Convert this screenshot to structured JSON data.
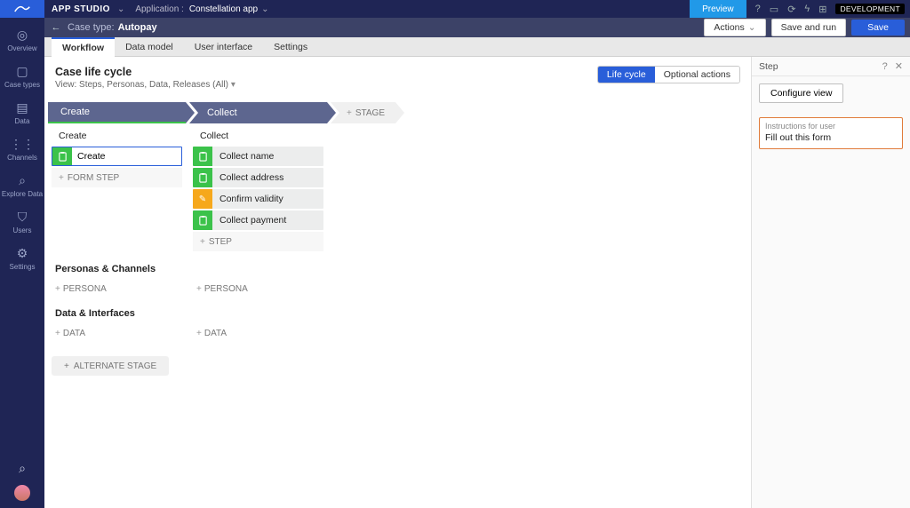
{
  "topbar": {
    "app_studio": "APP STUDIO",
    "application_label": "Application :",
    "application_value": "Constellation app",
    "preview": "Preview",
    "env_badge": "DEVELOPMENT"
  },
  "subbar": {
    "case_type_label": "Case type:",
    "case_type_value": "Autopay",
    "actions": "Actions",
    "save_and_run": "Save and run",
    "save": "Save"
  },
  "tabs": [
    "Workflow",
    "Data model",
    "User interface",
    "Settings"
  ],
  "leftnav": [
    {
      "icon": "◎",
      "label": "Overview"
    },
    {
      "icon": "▢",
      "label": "Case types"
    },
    {
      "icon": "▤",
      "label": "Data"
    },
    {
      "icon": "⋮⋮",
      "label": "Channels"
    },
    {
      "icon": "⌕",
      "label": "Explore Data"
    },
    {
      "icon": "⛉",
      "label": "Users"
    },
    {
      "icon": "⚙",
      "label": "Settings"
    }
  ],
  "canvas": {
    "title": "Case life cycle",
    "view_label": "View: Steps, Personas, Data, Releases (All)",
    "seg_life": "Life cycle",
    "seg_opt": "Optional actions",
    "add_stage": "STAGE",
    "form_step": "FORM STEP",
    "step_add": "STEP",
    "alt_stage": "ALTERNATE STAGE",
    "personas_h": "Personas & Channels",
    "persona_add": "PERSONA",
    "data_h": "Data & Interfaces",
    "data_add": "DATA",
    "stages": [
      {
        "name": "Create",
        "sub": "Create",
        "steps": [
          {
            "label": "Create",
            "selected": true,
            "color": "green"
          }
        ]
      },
      {
        "name": "Collect",
        "sub": "Collect",
        "steps": [
          {
            "label": "Collect name",
            "color": "green"
          },
          {
            "label": "Collect address",
            "color": "green"
          },
          {
            "label": "Confirm validity",
            "color": "orange"
          },
          {
            "label": "Collect payment",
            "color": "green"
          }
        ]
      }
    ]
  },
  "rpanel": {
    "title": "Step",
    "configure": "Configure view",
    "instructions_label": "Instructions for user",
    "instructions_value": "Fill out this form"
  }
}
